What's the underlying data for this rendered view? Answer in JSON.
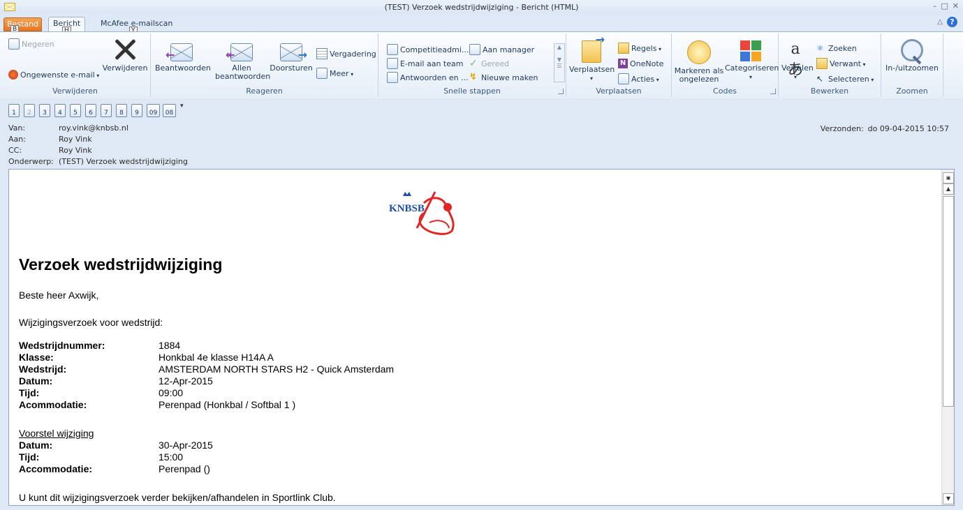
{
  "window": {
    "title": "(TEST) Verzoek wedstrijdwijziging  -  Bericht (HTML)",
    "controls": [
      "–",
      "□",
      "✕"
    ]
  },
  "tabs": {
    "file": "Bestand",
    "file_key": "B",
    "message": "Bericht",
    "message_key": "H",
    "mcafee": "McAfee e-mailscan",
    "mcafee_key": "Y"
  },
  "ribbon": {
    "delete_group": {
      "label": "Verwijderen",
      "ignore": "Negeren",
      "junk": "Ongewenste e-mail",
      "delete": "Verwijderen"
    },
    "respond_group": {
      "label": "Reageren",
      "reply": "Beantwoorden",
      "reply_all_1": "Allen",
      "reply_all_2": "beantwoorden",
      "forward": "Doorsturen",
      "meeting": "Vergadering",
      "more": "Meer"
    },
    "quicksteps_group": {
      "label": "Snelle stappen",
      "items": [
        "Competitieadmi...",
        "E-mail aan team",
        "Antwoorden en ...",
        "Aan manager",
        "Gereed",
        "Nieuwe maken"
      ]
    },
    "move_group": {
      "label": "Verplaatsen",
      "move": "Verplaatsen",
      "rules": "Regels",
      "onenote": "OneNote",
      "actions": "Acties"
    },
    "tags_group": {
      "label": "Codes",
      "mark_1": "Markeren als",
      "mark_2": "ongelezen",
      "categorize": "Categoriseren"
    },
    "edit_group": {
      "label": "Bewerken",
      "translate": "Vertalen",
      "find": "Zoeken",
      "related": "Verwant",
      "select": "Selecteren"
    },
    "zoom_group": {
      "label": "Zoomen",
      "zoom": "In-/uitzoomen"
    }
  },
  "quickaccess": {
    "keys": [
      "1",
      "2",
      "3",
      "4",
      "5",
      "6",
      "7",
      "8",
      "9",
      "09",
      "08"
    ]
  },
  "headers": {
    "from_label": "Van:",
    "from": "roy.vink@knbsb.nl",
    "to_label": "Aan:",
    "to": "Roy Vink",
    "cc_label": "CC:",
    "cc": "Roy Vink",
    "subject_label": "Onderwerp:",
    "subject": "(TEST) Verzoek wedstrijdwijziging",
    "sent_label": "Verzonden:",
    "sent": "do 09-04-2015 10:57"
  },
  "body": {
    "logo_text": "KNBSB",
    "heading": "Verzoek wedstrijdwijziging",
    "greeting": "Beste heer Axwijk,",
    "intro": "Wijzigingsverzoek voor wedstrijd:",
    "details": [
      {
        "k": "Wedstrijdnummer:",
        "v": "1884"
      },
      {
        "k": "Klasse:",
        "v": "Honkbal 4e klasse H14A A"
      },
      {
        "k": "Wedstrijd:",
        "v": "AMSTERDAM NORTH STARS H2 - Quick Amsterdam"
      },
      {
        "k": "Datum:",
        "v": "12-Apr-2015"
      },
      {
        "k": "Tijd:",
        "v": "09:00"
      },
      {
        "k": "Acommodatie:",
        "v": "Perenpad (Honkbal / Softbal 1 )"
      }
    ],
    "proposal_title": "Voorstel wijziging",
    "proposal": [
      {
        "k": "Datum:",
        "v": "30-Apr-2015"
      },
      {
        "k": "Tijd:",
        "v": "15:00"
      },
      {
        "k": "Accommodatie:",
        "v": "Perenpad ()"
      }
    ],
    "footer": "U kunt dit wijzigingsverzoek verder bekijken/afhandelen in Sportlink Club."
  }
}
